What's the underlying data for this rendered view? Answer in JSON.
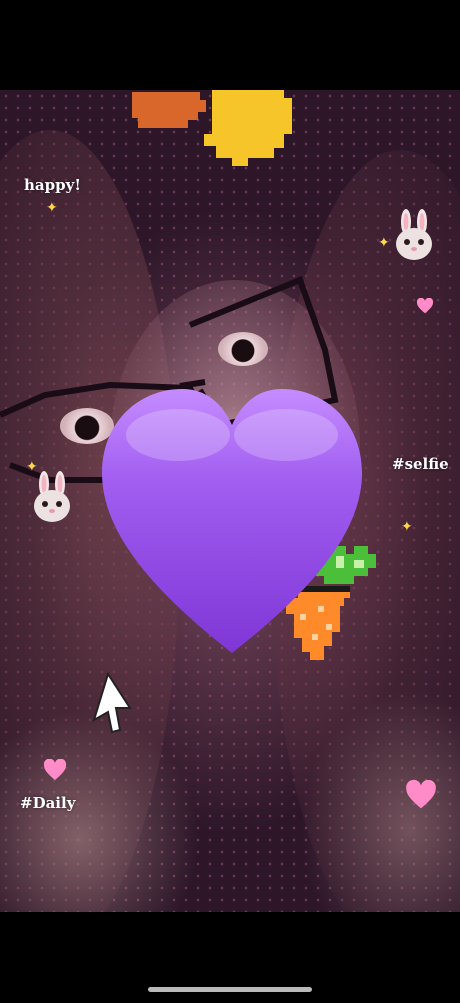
{
  "stickers": {
    "happy": "happy!",
    "selfie": "#selfie",
    "daily": "#Daily"
  },
  "colors": {
    "big_heart": "#9b4de6",
    "big_heart_highlight": "#c58cff",
    "small_heart": "#ff8cc8",
    "sparkle": "#ffd84a",
    "pixel_orange": "#d9662a",
    "pixel_yellow": "#f5c52a",
    "carrot_leaf": "#4cbf3a",
    "background": "#000000"
  },
  "icons": [
    "bunny-icon",
    "sparkle-icon",
    "small-heart-icon",
    "pixel-carrot-icon",
    "pixel-cursor-icon",
    "pixel-glasses",
    "big-purple-heart-icon"
  ]
}
